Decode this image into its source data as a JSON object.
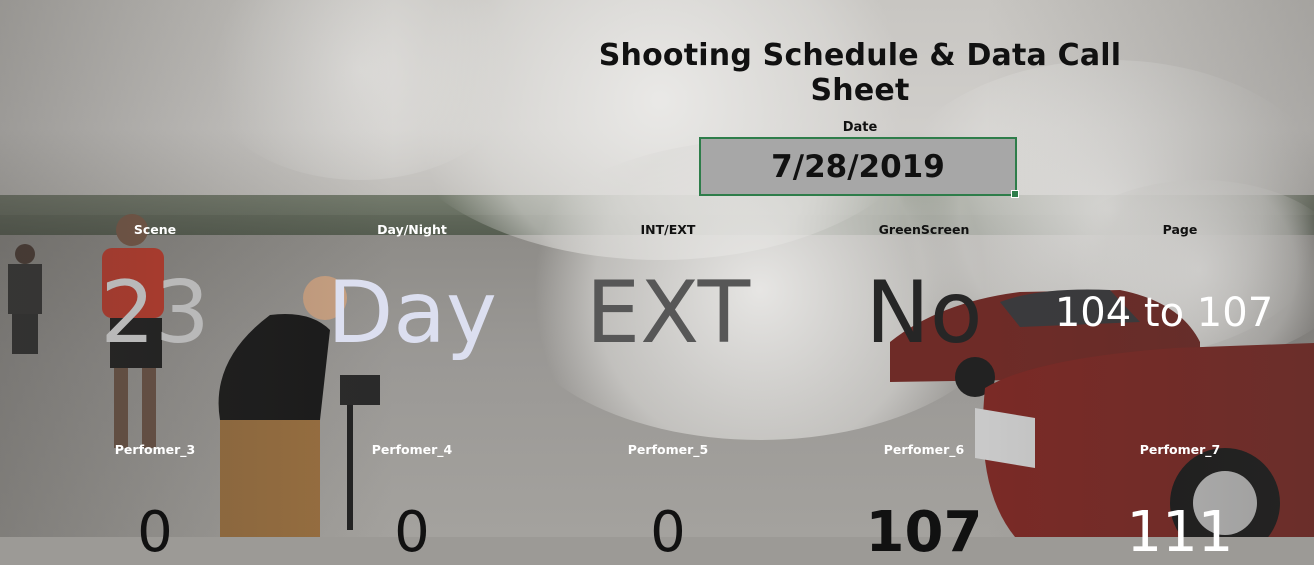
{
  "sheet": {
    "title": "Shooting Schedule & Data Call Sheet",
    "date_label": "Date",
    "date_value": "7/28/2019"
  },
  "fields_row1": [
    {
      "label": "Scene",
      "value": "23"
    },
    {
      "label": "Day/Night",
      "value": "Day"
    },
    {
      "label": "INT/EXT",
      "value": "EXT"
    },
    {
      "label": "GreenScreen",
      "value": "No"
    },
    {
      "label": "Page",
      "value": "104 to 107"
    }
  ],
  "fields_row2": [
    {
      "label": "Perfomer_3",
      "value": "0"
    },
    {
      "label": "Perfomer_4",
      "value": "0"
    },
    {
      "label": "Perfomer_5",
      "value": "0"
    },
    {
      "label": "Perfomer_6",
      "value": "107"
    },
    {
      "label": "Perfomer_7",
      "value": "111"
    }
  ],
  "colors": {
    "date_cell_fill": "#a7a7a7",
    "date_cell_border": "#2e7d4a",
    "title_text": "#111111"
  }
}
